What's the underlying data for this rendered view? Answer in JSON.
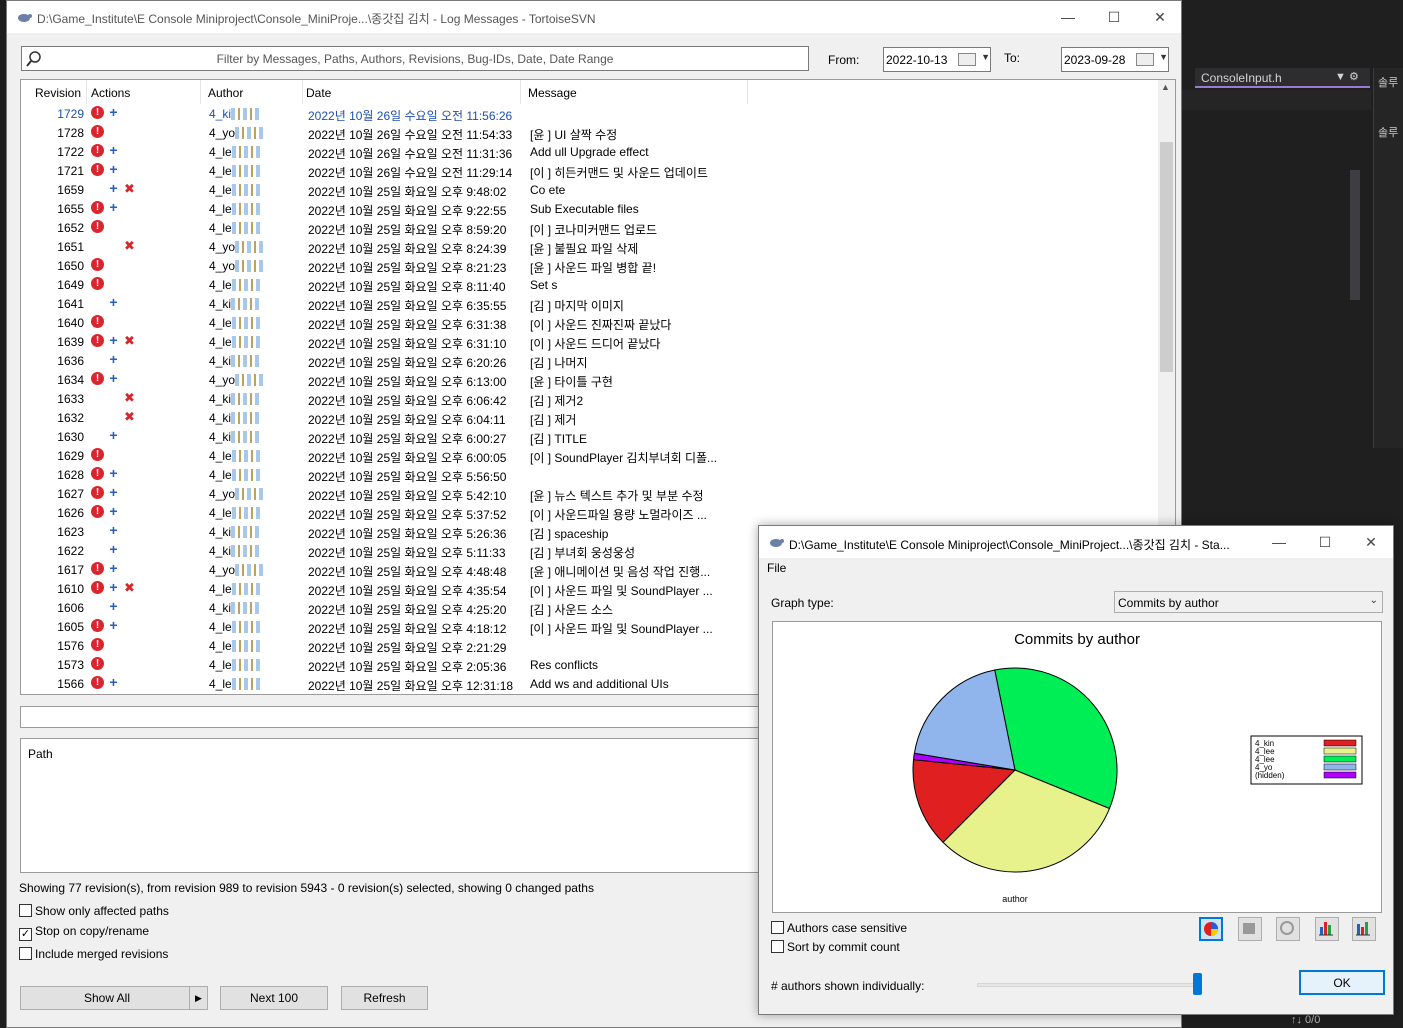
{
  "ide": {
    "tab_label": "ConsoleInput.h",
    "side_labels": [
      "솔루",
      "솔루"
    ],
    "status": "↑↓ 0/0"
  },
  "main_window": {
    "title": "D:\\Game_Institute\\E Console Miniproject\\Console_MiniProje...\\종갓집 김치 - Log Messages - TortoiseSVN",
    "filter_placeholder": "Filter by Messages, Paths, Authors, Revisions, Bug-IDs, Date, Date Range",
    "from_label": "From:",
    "from_date": "2022-10-13",
    "to_label": "To:",
    "to_date": "2023-09-28",
    "columns": [
      "Revision",
      "Actions",
      "Author",
      "Date",
      "Message"
    ],
    "rows": [
      {
        "rev": "1729",
        "acts": [
          "mod",
          "add"
        ],
        "author": "4_ki",
        "date": "2022년 10월 26일 수요일 오전 11:56:26",
        "msg": "",
        "selected": true
      },
      {
        "rev": "1728",
        "acts": [
          "mod"
        ],
        "author": "4_yo",
        "date": "2022년 10월 26일 수요일 오전 11:54:33",
        "msg": "[윤 ] UI 살짝 수정"
      },
      {
        "rev": "1722",
        "acts": [
          "mod",
          "add"
        ],
        "author": "4_le",
        "date": "2022년 10월 26일 수요일 오전 11:31:36",
        "msg": "Add ull Upgrade effect"
      },
      {
        "rev": "1721",
        "acts": [
          "mod",
          "add"
        ],
        "author": "4_le",
        "date": "2022년 10월 26일 수요일 오전 11:29:14",
        "msg": "[이 ] 히든커맨드 및 사운드 업데이트"
      },
      {
        "rev": "1659",
        "acts": [
          "add",
          "del"
        ],
        "author": "4_le",
        "date": "2022년 10월 25일 화요일 오후 9:48:02",
        "msg": "Co ete"
      },
      {
        "rev": "1655",
        "acts": [
          "mod",
          "add"
        ],
        "author": "4_le",
        "date": "2022년 10월 25일 화요일 오후 9:22:55",
        "msg": "Sub Executable files"
      },
      {
        "rev": "1652",
        "acts": [
          "mod"
        ],
        "author": "4_le",
        "date": "2022년 10월 25일 화요일 오후 8:59:20",
        "msg": "[이 ] 코나미커맨드 업로드"
      },
      {
        "rev": "1651",
        "acts": [
          "del"
        ],
        "author": "4_yo",
        "date": "2022년 10월 25일 화요일 오후 8:24:39",
        "msg": "[윤 ] 불필요 파일 삭제"
      },
      {
        "rev": "1650",
        "acts": [
          "mod"
        ],
        "author": "4_yo",
        "date": "2022년 10월 25일 화요일 오후 8:21:23",
        "msg": "[윤 ] 사운드 파일 병합 끝!"
      },
      {
        "rev": "1649",
        "acts": [
          "mod"
        ],
        "author": "4_le",
        "date": "2022년 10월 25일 화요일 오후 8:11:40",
        "msg": "Set s"
      },
      {
        "rev": "1641",
        "acts": [
          "add"
        ],
        "author": "4_ki",
        "date": "2022년 10월 25일 화요일 오후 6:35:55",
        "msg": "[김 ] 마지막 이미지"
      },
      {
        "rev": "1640",
        "acts": [
          "mod"
        ],
        "author": "4_le",
        "date": "2022년 10월 25일 화요일 오후 6:31:38",
        "msg": "[이 ] 사운드 진짜진짜 끝났다"
      },
      {
        "rev": "1639",
        "acts": [
          "mod",
          "add",
          "del"
        ],
        "author": "4_le",
        "date": "2022년 10월 25일 화요일 오후 6:31:10",
        "msg": "[이 ] 사운드 드디어 끝났다"
      },
      {
        "rev": "1636",
        "acts": [
          "add"
        ],
        "author": "4_ki",
        "date": "2022년 10월 25일 화요일 오후 6:20:26",
        "msg": "[김 ] 나머지"
      },
      {
        "rev": "1634",
        "acts": [
          "mod",
          "add"
        ],
        "author": "4_yo",
        "date": "2022년 10월 25일 화요일 오후 6:13:00",
        "msg": "[윤 ] 타이틀 구현"
      },
      {
        "rev": "1633",
        "acts": [
          "del"
        ],
        "author": "4_ki",
        "date": "2022년 10월 25일 화요일 오후 6:06:42",
        "msg": "[김 ] 제거2"
      },
      {
        "rev": "1632",
        "acts": [
          "del"
        ],
        "author": "4_ki",
        "date": "2022년 10월 25일 화요일 오후 6:04:11",
        "msg": "[김 ] 제거"
      },
      {
        "rev": "1630",
        "acts": [
          "add"
        ],
        "author": "4_ki",
        "date": "2022년 10월 25일 화요일 오후 6:00:27",
        "msg": "[김 ] TITLE"
      },
      {
        "rev": "1629",
        "acts": [
          "mod"
        ],
        "author": "4_le",
        "date": "2022년 10월 25일 화요일 오후 6:00:05",
        "msg": "[이 ] SoundPlayer 김치부녀회 디폴..."
      },
      {
        "rev": "1628",
        "acts": [
          "mod",
          "add"
        ],
        "author": "4_le",
        "date": "2022년 10월 25일 화요일 오후 5:56:50",
        "msg": ""
      },
      {
        "rev": "1627",
        "acts": [
          "mod",
          "add"
        ],
        "author": "4_yo",
        "date": "2022년 10월 25일 화요일 오후 5:42:10",
        "msg": "[윤 ] 뉴스 텍스트 추가 및 부분 수정"
      },
      {
        "rev": "1626",
        "acts": [
          "mod",
          "add"
        ],
        "author": "4_le",
        "date": "2022년 10월 25일 화요일 오후 5:37:52",
        "msg": "[이 ] 사운드파일 용량 노멀라이즈 ..."
      },
      {
        "rev": "1623",
        "acts": [
          "add"
        ],
        "author": "4_ki",
        "date": "2022년 10월 25일 화요일 오후 5:26:36",
        "msg": "[김 ] spaceship"
      },
      {
        "rev": "1622",
        "acts": [
          "add"
        ],
        "author": "4_ki",
        "date": "2022년 10월 25일 화요일 오후 5:11:33",
        "msg": "[김 ] 부녀회 웅성웅성"
      },
      {
        "rev": "1617",
        "acts": [
          "mod",
          "add"
        ],
        "author": "4_yo",
        "date": "2022년 10월 25일 화요일 오후 4:48:48",
        "msg": "[윤 ] 애니메이션 및 음성 작업 진행..."
      },
      {
        "rev": "1610",
        "acts": [
          "mod",
          "add",
          "del"
        ],
        "author": "4_le",
        "date": "2022년 10월 25일 화요일 오후 4:35:54",
        "msg": "[이 ] 사운드 파일 및 SoundPlayer ..."
      },
      {
        "rev": "1606",
        "acts": [
          "add"
        ],
        "author": "4_ki",
        "date": "2022년 10월 25일 화요일 오후 4:25:20",
        "msg": "[김 ] 사운드 소스"
      },
      {
        "rev": "1605",
        "acts": [
          "mod",
          "add"
        ],
        "author": "4_le",
        "date": "2022년 10월 25일 화요일 오후 4:18:12",
        "msg": "[이 ] 사운드 파일 및 SoundPlayer ..."
      },
      {
        "rev": "1576",
        "acts": [
          "mod"
        ],
        "author": "4_le",
        "date": "2022년 10월 25일 화요일 오후 2:21:29",
        "msg": ""
      },
      {
        "rev": "1573",
        "acts": [
          "mod"
        ],
        "author": "4_le",
        "date": "2022년 10월 25일 화요일 오후 2:05:36",
        "msg": "Res conflicts"
      },
      {
        "rev": "1566",
        "acts": [
          "mod",
          "add"
        ],
        "author": "4_le",
        "date": "2022년 10월 25일 화요일 오후 12:31:18",
        "msg": "Add ws and additional UIs"
      }
    ],
    "path_header": "Path",
    "status_text": "Showing 77 revision(s), from revision 989 to revision 5943 - 0 revision(s) selected, showing 0 changed paths",
    "options": [
      {
        "label": "Show only affected paths",
        "checked": false
      },
      {
        "label": "Stop on copy/rename",
        "checked": true
      },
      {
        "label": "Include merged revisions",
        "checked": false
      }
    ],
    "buttons": {
      "show_all": "Show All",
      "next": "Next 100",
      "refresh": "Refresh"
    }
  },
  "stats_window": {
    "title": "D:\\Game_Institute\\E Console Miniproject\\Console_MiniProject...\\종갓집 김치 - Sta...",
    "menu_file": "File",
    "graph_type_label": "Graph type:",
    "graph_type_value": "Commits by author",
    "authors_case": "Authors case sensitive",
    "sort_by_count": "Sort by commit count",
    "authors_shown_label": "# authors shown individually:",
    "ok": "OK"
  },
  "chart_data": {
    "type": "pie",
    "title": "Commits by author",
    "xlabel": "author",
    "legend_position": "right",
    "slices": [
      {
        "name": "4_kin",
        "value": 14,
        "color": "#e02020"
      },
      {
        "name": "4_lee",
        "value": 31,
        "color": "#e8f28c"
      },
      {
        "name": "4_lee",
        "value": 34,
        "color": "#00ee55"
      },
      {
        "name": "4_yo",
        "value": 19,
        "color": "#90b4ec"
      },
      {
        "name": "(hidden)",
        "value": 1,
        "color": "#b000ff"
      }
    ]
  }
}
